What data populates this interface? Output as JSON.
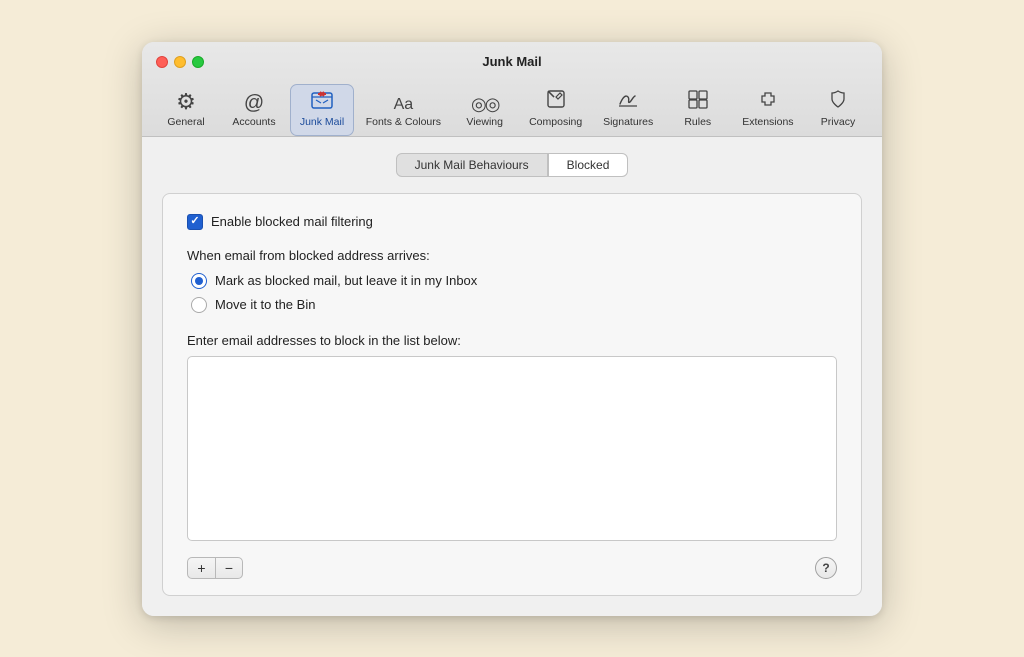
{
  "window": {
    "title": "Junk Mail"
  },
  "toolbar": {
    "items": [
      {
        "id": "general",
        "label": "General",
        "icon": "⚙"
      },
      {
        "id": "accounts",
        "label": "Accounts",
        "icon": "@"
      },
      {
        "id": "junk-mail",
        "label": "Junk Mail",
        "icon": "✉",
        "active": true
      },
      {
        "id": "fonts-colours",
        "label": "Fonts & Colours",
        "icon": "Aa"
      },
      {
        "id": "viewing",
        "label": "Viewing",
        "icon": "◎"
      },
      {
        "id": "composing",
        "label": "Composing",
        "icon": "✏"
      },
      {
        "id": "signatures",
        "label": "Signatures",
        "icon": "✍"
      },
      {
        "id": "rules",
        "label": "Rules",
        "icon": "⧉"
      },
      {
        "id": "extensions",
        "label": "Extensions",
        "icon": "✦"
      },
      {
        "id": "privacy",
        "label": "Privacy",
        "icon": "✋"
      }
    ]
  },
  "tabs": [
    {
      "id": "junk-mail-behaviours",
      "label": "Junk Mail Behaviours",
      "active": false
    },
    {
      "id": "blocked",
      "label": "Blocked",
      "active": true
    }
  ],
  "panel": {
    "checkbox_label": "Enable blocked mail filtering",
    "section_label": "When email from blocked address arrives:",
    "radio_options": [
      {
        "id": "mark-blocked",
        "label": "Mark as blocked mail, but leave it in my Inbox",
        "selected": true
      },
      {
        "id": "move-to-bin",
        "label": "Move it to the Bin",
        "selected": false
      }
    ],
    "list_label": "Enter email addresses to block in the list below:",
    "add_button": "+",
    "remove_button": "−",
    "help_button": "?"
  }
}
